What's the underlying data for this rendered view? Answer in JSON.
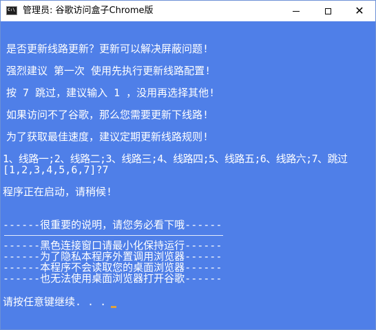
{
  "window": {
    "title": "管理员:  谷歌访问盒子Chrome版",
    "app_icon_text": "C:\\",
    "minimize_symbol": "—",
    "maximize_symbol": "☐",
    "close_symbol": "✕",
    "colors": {
      "console_bg": "#4f7fe8",
      "text": "#ffffff",
      "cursor": "#e2a23b"
    }
  },
  "console": {
    "lines": [
      "是否更新线路更新？更新可以解决屏蔽问题!",
      "强烈建议 第一次 使用先执行更新线路配置!",
      "按 7 跳过，建议输入 1 ，没用再选择其他!",
      "如果访问不了谷歌，那么您需要更新下线路!",
      "为了获取最佳速度，建议定期更新线路规则!",
      "1、线路一;2、线路二;3、线路三;4、线路四;5、线路五;6、线路六;7、跳过",
      "[1,2,3,4,5,6,7]?7",
      "程序正在启动，请稍候!",
      "------很重要的说明，请您务必看下哦------",
      "------黑色连接窗口请最小化保持运行------",
      "------为了隐私本程序外置调用浏览器------",
      "------本程序不会读取您的桌面浏览器------",
      "------也无法使用桌面浏览器打开谷歌------",
      "请按任意键继续. . ."
    ]
  }
}
